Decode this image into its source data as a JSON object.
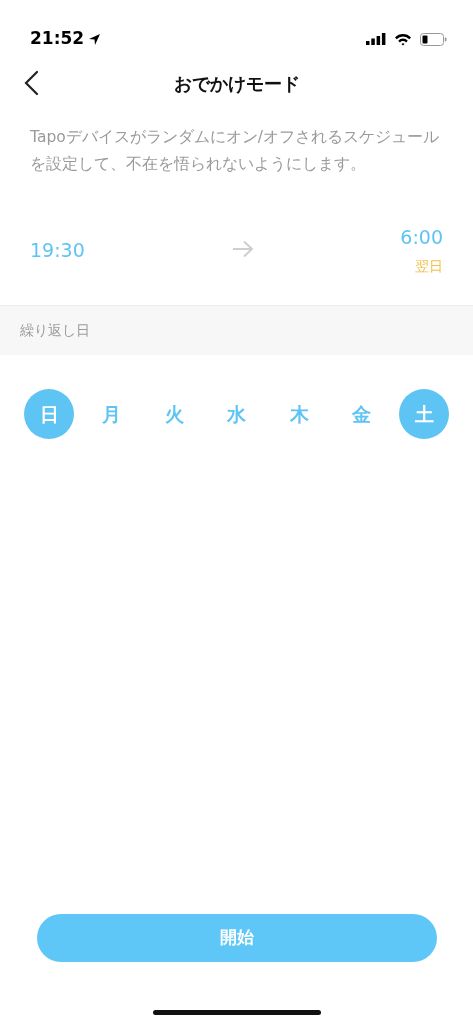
{
  "status_bar": {
    "time": "21:52"
  },
  "header": {
    "title": "おでかけモード"
  },
  "description": "Tapoデバイスがランダムにオン/オフされるスケジュールを設定して、不在を悟られないようにします。",
  "schedule": {
    "start": "19:30",
    "end": "6:00",
    "end_note": "翌日"
  },
  "repeat": {
    "label": "繰り返し日",
    "days": [
      {
        "label": "日",
        "selected": true
      },
      {
        "label": "月",
        "selected": false
      },
      {
        "label": "火",
        "selected": false
      },
      {
        "label": "水",
        "selected": false
      },
      {
        "label": "木",
        "selected": false
      },
      {
        "label": "金",
        "selected": false
      },
      {
        "label": "土",
        "selected": true
      }
    ]
  },
  "start_button": "開始"
}
